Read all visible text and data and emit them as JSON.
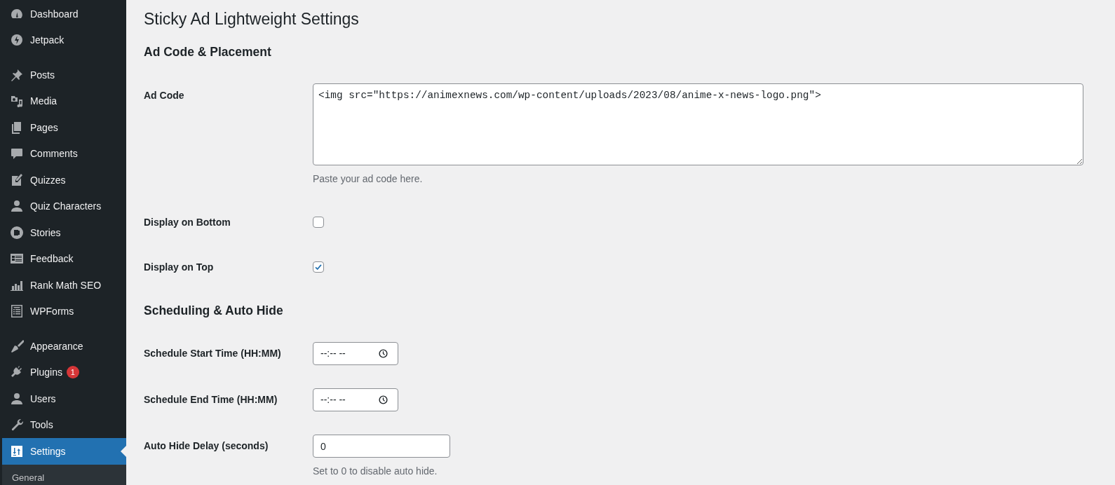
{
  "sidebar": {
    "groups": [
      [
        {
          "label": "Dashboard",
          "selected": false
        },
        {
          "label": "Jetpack",
          "selected": false
        }
      ],
      [
        {
          "label": "Posts",
          "selected": false
        },
        {
          "label": "Media",
          "selected": false
        },
        {
          "label": "Pages",
          "selected": false
        },
        {
          "label": "Comments",
          "selected": false
        },
        {
          "label": "Quizzes",
          "selected": false
        },
        {
          "label": "Quiz Characters",
          "selected": false
        },
        {
          "label": "Stories",
          "selected": false
        },
        {
          "label": "Feedback",
          "selected": false
        },
        {
          "label": "Rank Math SEO",
          "selected": false
        },
        {
          "label": "WPForms",
          "selected": false
        }
      ],
      [
        {
          "label": "Appearance",
          "selected": false
        },
        {
          "label": "Plugins",
          "selected": false,
          "badge": "1"
        },
        {
          "label": "Users",
          "selected": false
        },
        {
          "label": "Tools",
          "selected": false
        },
        {
          "label": "Settings",
          "selected": true,
          "submenu": [
            {
              "label": "General",
              "selected": false
            }
          ]
        }
      ]
    ]
  },
  "page_title": "Sticky Ad Lightweight Settings",
  "sections": [
    {
      "heading": "Ad Code & Placement",
      "fields": [
        {
          "kind": "textarea",
          "label": "Ad Code",
          "value": "<img src=\"https://animexnews.com/wp-content/uploads/2023/08/anime-x-news-logo.png\">",
          "description": "Paste your ad code here."
        },
        {
          "kind": "checkbox",
          "label": "Display on Bottom",
          "checked": false
        },
        {
          "kind": "checkbox",
          "label": "Display on Top",
          "checked": true
        }
      ]
    },
    {
      "heading": "Scheduling & Auto Hide",
      "fields": [
        {
          "kind": "time",
          "label": "Schedule Start Time (HH:MM)",
          "placeholder": "--:-- --"
        },
        {
          "kind": "time",
          "label": "Schedule End Time (HH:MM)",
          "placeholder": "--:-- --"
        },
        {
          "kind": "number",
          "label": "Auto Hide Delay (seconds)",
          "value": "0",
          "description": "Set to 0 to disable auto hide."
        }
      ]
    }
  ]
}
